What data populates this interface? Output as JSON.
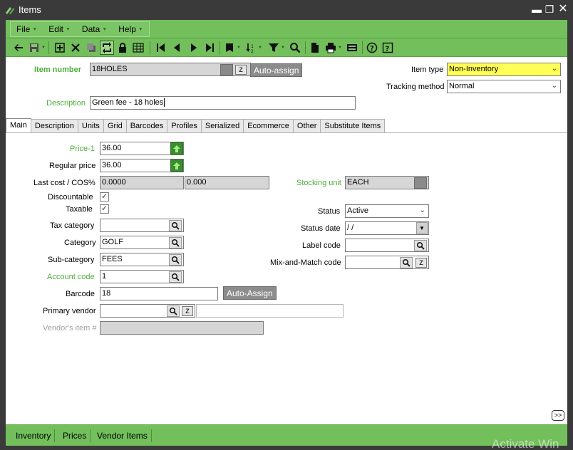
{
  "window": {
    "title": "Items"
  },
  "menu": [
    {
      "label": "File",
      "key": "F"
    },
    {
      "label": "Edit",
      "key": "E"
    },
    {
      "label": "Data",
      "key": "D"
    },
    {
      "label": "Help",
      "key": "H"
    }
  ],
  "menu_labels": {
    "file": "File",
    "edit": "Edit",
    "data": "Data",
    "help": "Help"
  },
  "header": {
    "item_number_label": "Item number",
    "item_number_value": "18HOLES",
    "auto_assign_label": "Auto-assign",
    "description_label": "Description",
    "description_value": "Green fee - 18 holes",
    "item_type_label": "Item type",
    "item_type_value": "Non-Inventory",
    "tracking_method_label": "Tracking method",
    "tracking_method_value": "Normal"
  },
  "tabs": [
    "Main",
    "Description",
    "Units",
    "Grid",
    "Barcodes",
    "Profiles",
    "Serialized",
    "Ecommerce",
    "Other",
    "Substitute Items"
  ],
  "main": {
    "price1_label": "Price-1",
    "price1_value": "36.00",
    "regular_price_label": "Regular price",
    "regular_price_value": "36.00",
    "last_cost_label": "Last cost / COS%",
    "last_cost_value": "0.0000",
    "cos_value": "0.000",
    "discountable_label": "Discountable",
    "discountable_checked": true,
    "taxable_label": "Taxable",
    "taxable_checked": true,
    "tax_category_label": "Tax category",
    "tax_category_value": "",
    "category_label": "Category",
    "category_value": "GOLF",
    "sub_category_label": "Sub-category",
    "sub_category_value": "FEES",
    "account_code_label": "Account code",
    "account_code_value": "1",
    "barcode_label": "Barcode",
    "barcode_value": "18",
    "barcode_auto_assign_label": "Auto-Assign",
    "primary_vendor_label": "Primary vendor",
    "primary_vendor_value": "",
    "primary_vendor_name": "",
    "vendors_item_label": "Vendor's item #",
    "vendors_item_value": "",
    "stocking_unit_label": "Stocking unit",
    "stocking_unit_value": "EACH",
    "status_label": "Status",
    "status_value": "Active",
    "status_date_label": "Status date",
    "status_date_value": " /  /",
    "label_code_label": "Label code",
    "label_code_value": "",
    "mix_match_label": "Mix-and-Match code",
    "mix_match_value": "",
    "more_label": ">>"
  },
  "bottom_tabs": [
    "Inventory",
    "Prices",
    "Vendor Items"
  ],
  "bottom": {
    "inventory": "Inventory",
    "prices": "Prices",
    "vendor_items": "Vendor Items"
  },
  "watermark": "Activate Win",
  "colors": {
    "accent_green": "#72bf5c",
    "label_green": "#4caf3a",
    "titlebar": "#3a3a3a",
    "highlight_yellow": "#ffff55"
  }
}
